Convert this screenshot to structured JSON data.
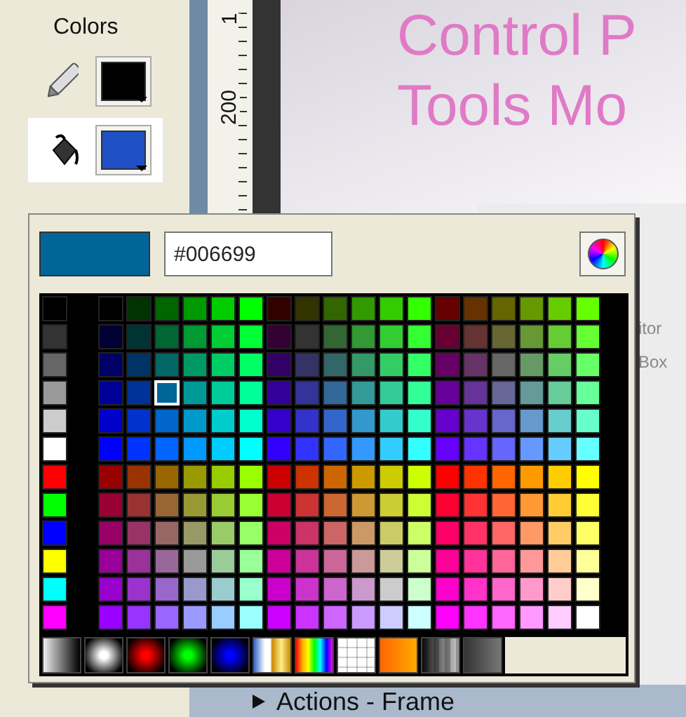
{
  "tools_panel": {
    "title": "Colors",
    "tools": [
      {
        "kind": "stroke",
        "color": "#000000",
        "selected": false
      },
      {
        "kind": "fill",
        "color": "#1f4fc4",
        "selected": true
      }
    ]
  },
  "ruler": {
    "labels": [
      "1",
      "200"
    ]
  },
  "stage": {
    "lines": [
      "Control P",
      "Tools Mo"
    ],
    "fragments": [
      "itor",
      "Box"
    ]
  },
  "palette": {
    "preview": {
      "color": "#006699"
    },
    "hex": {
      "value": "#006699"
    },
    "rows": [
      {
        "left": {
          "color": "#000000",
          "selected": false
        },
        "swatches": [
          {
            "color": "#000000",
            "selected": false
          },
          {
            "color": "#003300",
            "selected": false
          },
          {
            "color": "#006600",
            "selected": false
          },
          {
            "color": "#009900",
            "selected": false
          },
          {
            "color": "#00cc00",
            "selected": false
          },
          {
            "color": "#00ff00",
            "selected": false
          },
          {
            "color": "#330000",
            "selected": false
          },
          {
            "color": "#333300",
            "selected": false
          },
          {
            "color": "#336600",
            "selected": false
          },
          {
            "color": "#339900",
            "selected": false
          },
          {
            "color": "#33cc00",
            "selected": false
          },
          {
            "color": "#33ff00",
            "selected": false
          },
          {
            "color": "#660000",
            "selected": false
          },
          {
            "color": "#663300",
            "selected": false
          },
          {
            "color": "#666600",
            "selected": false
          },
          {
            "color": "#669900",
            "selected": false
          },
          {
            "color": "#66cc00",
            "selected": false
          },
          {
            "color": "#66ff00",
            "selected": false
          }
        ]
      },
      {
        "left": {
          "color": "#333333",
          "selected": false
        },
        "swatches": [
          {
            "color": "#000033",
            "selected": false
          },
          {
            "color": "#003333",
            "selected": false
          },
          {
            "color": "#006633",
            "selected": false
          },
          {
            "color": "#009933",
            "selected": false
          },
          {
            "color": "#00cc33",
            "selected": false
          },
          {
            "color": "#00ff33",
            "selected": false
          },
          {
            "color": "#330033",
            "selected": false
          },
          {
            "color": "#333333",
            "selected": false
          },
          {
            "color": "#336633",
            "selected": false
          },
          {
            "color": "#339933",
            "selected": false
          },
          {
            "color": "#33cc33",
            "selected": false
          },
          {
            "color": "#33ff33",
            "selected": false
          },
          {
            "color": "#660033",
            "selected": false
          },
          {
            "color": "#663333",
            "selected": false
          },
          {
            "color": "#666633",
            "selected": false
          },
          {
            "color": "#669933",
            "selected": false
          },
          {
            "color": "#66cc33",
            "selected": false
          },
          {
            "color": "#66ff33",
            "selected": false
          }
        ]
      },
      {
        "left": {
          "color": "#666666",
          "selected": false
        },
        "swatches": [
          {
            "color": "#000066",
            "selected": false
          },
          {
            "color": "#003366",
            "selected": false
          },
          {
            "color": "#006666",
            "selected": false
          },
          {
            "color": "#009966",
            "selected": false
          },
          {
            "color": "#00cc66",
            "selected": false
          },
          {
            "color": "#00ff66",
            "selected": false
          },
          {
            "color": "#330066",
            "selected": false
          },
          {
            "color": "#333366",
            "selected": false
          },
          {
            "color": "#336666",
            "selected": false
          },
          {
            "color": "#339966",
            "selected": false
          },
          {
            "color": "#33cc66",
            "selected": false
          },
          {
            "color": "#33ff66",
            "selected": false
          },
          {
            "color": "#660066",
            "selected": false
          },
          {
            "color": "#663366",
            "selected": false
          },
          {
            "color": "#666666",
            "selected": false
          },
          {
            "color": "#669966",
            "selected": false
          },
          {
            "color": "#66cc66",
            "selected": false
          },
          {
            "color": "#66ff66",
            "selected": false
          }
        ]
      },
      {
        "left": {
          "color": "#999999",
          "selected": false
        },
        "swatches": [
          {
            "color": "#000099",
            "selected": false
          },
          {
            "color": "#003399",
            "selected": false
          },
          {
            "color": "#006699",
            "selected": true
          },
          {
            "color": "#009999",
            "selected": false
          },
          {
            "color": "#00cc99",
            "selected": false
          },
          {
            "color": "#00ff99",
            "selected": false
          },
          {
            "color": "#330099",
            "selected": false
          },
          {
            "color": "#333399",
            "selected": false
          },
          {
            "color": "#336699",
            "selected": false
          },
          {
            "color": "#339999",
            "selected": false
          },
          {
            "color": "#33cc99",
            "selected": false
          },
          {
            "color": "#33ff99",
            "selected": false
          },
          {
            "color": "#660099",
            "selected": false
          },
          {
            "color": "#663399",
            "selected": false
          },
          {
            "color": "#666699",
            "selected": false
          },
          {
            "color": "#669999",
            "selected": false
          },
          {
            "color": "#66cc99",
            "selected": false
          },
          {
            "color": "#66ff99",
            "selected": false
          }
        ]
      },
      {
        "left": {
          "color": "#cccccc",
          "selected": false
        },
        "swatches": [
          {
            "color": "#0000cc",
            "selected": false
          },
          {
            "color": "#0033cc",
            "selected": false
          },
          {
            "color": "#0066cc",
            "selected": false
          },
          {
            "color": "#0099cc",
            "selected": false
          },
          {
            "color": "#00cccc",
            "selected": false
          },
          {
            "color": "#00ffcc",
            "selected": false
          },
          {
            "color": "#3300cc",
            "selected": false
          },
          {
            "color": "#3333cc",
            "selected": false
          },
          {
            "color": "#3366cc",
            "selected": false
          },
          {
            "color": "#3399cc",
            "selected": false
          },
          {
            "color": "#33cccc",
            "selected": false
          },
          {
            "color": "#33ffcc",
            "selected": false
          },
          {
            "color": "#6600cc",
            "selected": false
          },
          {
            "color": "#6633cc",
            "selected": false
          },
          {
            "color": "#6666cc",
            "selected": false
          },
          {
            "color": "#6699cc",
            "selected": false
          },
          {
            "color": "#66cccc",
            "selected": false
          },
          {
            "color": "#66ffcc",
            "selected": false
          }
        ]
      },
      {
        "left": {
          "color": "#ffffff",
          "selected": false
        },
        "swatches": [
          {
            "color": "#0000ff",
            "selected": false
          },
          {
            "color": "#0033ff",
            "selected": false
          },
          {
            "color": "#0066ff",
            "selected": false
          },
          {
            "color": "#0099ff",
            "selected": false
          },
          {
            "color": "#00ccff",
            "selected": false
          },
          {
            "color": "#00ffff",
            "selected": false
          },
          {
            "color": "#3300ff",
            "selected": false
          },
          {
            "color": "#3333ff",
            "selected": false
          },
          {
            "color": "#3366ff",
            "selected": false
          },
          {
            "color": "#3399ff",
            "selected": false
          },
          {
            "color": "#33ccff",
            "selected": false
          },
          {
            "color": "#33ffff",
            "selected": false
          },
          {
            "color": "#6600ff",
            "selected": false
          },
          {
            "color": "#6633ff",
            "selected": false
          },
          {
            "color": "#6666ff",
            "selected": false
          },
          {
            "color": "#6699ff",
            "selected": false
          },
          {
            "color": "#66ccff",
            "selected": false
          },
          {
            "color": "#66ffff",
            "selected": false
          }
        ]
      },
      {
        "left": {
          "color": "#ff0000",
          "selected": false
        },
        "swatches": [
          {
            "color": "#990000",
            "selected": false
          },
          {
            "color": "#993300",
            "selected": false
          },
          {
            "color": "#996600",
            "selected": false
          },
          {
            "color": "#999900",
            "selected": false
          },
          {
            "color": "#99cc00",
            "selected": false
          },
          {
            "color": "#99ff00",
            "selected": false
          },
          {
            "color": "#cc0000",
            "selected": false
          },
          {
            "color": "#cc3300",
            "selected": false
          },
          {
            "color": "#cc6600",
            "selected": false
          },
          {
            "color": "#cc9900",
            "selected": false
          },
          {
            "color": "#cccc00",
            "selected": false
          },
          {
            "color": "#ccff00",
            "selected": false
          },
          {
            "color": "#ff0000",
            "selected": false
          },
          {
            "color": "#ff3300",
            "selected": false
          },
          {
            "color": "#ff6600",
            "selected": false
          },
          {
            "color": "#ff9900",
            "selected": false
          },
          {
            "color": "#ffcc00",
            "selected": false
          },
          {
            "color": "#ffff00",
            "selected": false
          }
        ]
      },
      {
        "left": {
          "color": "#00ff00",
          "selected": false
        },
        "swatches": [
          {
            "color": "#990033",
            "selected": false
          },
          {
            "color": "#993333",
            "selected": false
          },
          {
            "color": "#996633",
            "selected": false
          },
          {
            "color": "#999933",
            "selected": false
          },
          {
            "color": "#99cc33",
            "selected": false
          },
          {
            "color": "#99ff33",
            "selected": false
          },
          {
            "color": "#cc0033",
            "selected": false
          },
          {
            "color": "#cc3333",
            "selected": false
          },
          {
            "color": "#cc6633",
            "selected": false
          },
          {
            "color": "#cc9933",
            "selected": false
          },
          {
            "color": "#cccc33",
            "selected": false
          },
          {
            "color": "#ccff33",
            "selected": false
          },
          {
            "color": "#ff0033",
            "selected": false
          },
          {
            "color": "#ff3333",
            "selected": false
          },
          {
            "color": "#ff6633",
            "selected": false
          },
          {
            "color": "#ff9933",
            "selected": false
          },
          {
            "color": "#ffcc33",
            "selected": false
          },
          {
            "color": "#ffff33",
            "selected": false
          }
        ]
      },
      {
        "left": {
          "color": "#0000ff",
          "selected": false
        },
        "swatches": [
          {
            "color": "#990066",
            "selected": false
          },
          {
            "color": "#993366",
            "selected": false
          },
          {
            "color": "#996666",
            "selected": false
          },
          {
            "color": "#999966",
            "selected": false
          },
          {
            "color": "#99cc66",
            "selected": false
          },
          {
            "color": "#99ff66",
            "selected": false
          },
          {
            "color": "#cc0066",
            "selected": false
          },
          {
            "color": "#cc3366",
            "selected": false
          },
          {
            "color": "#cc6666",
            "selected": false
          },
          {
            "color": "#cc9966",
            "selected": false
          },
          {
            "color": "#cccc66",
            "selected": false
          },
          {
            "color": "#ccff66",
            "selected": false
          },
          {
            "color": "#ff0066",
            "selected": false
          },
          {
            "color": "#ff3366",
            "selected": false
          },
          {
            "color": "#ff6666",
            "selected": false
          },
          {
            "color": "#ff9966",
            "selected": false
          },
          {
            "color": "#ffcc66",
            "selected": false
          },
          {
            "color": "#ffff66",
            "selected": false
          }
        ]
      },
      {
        "left": {
          "color": "#ffff00",
          "selected": false
        },
        "swatches": [
          {
            "color": "#990099",
            "selected": false
          },
          {
            "color": "#993399",
            "selected": false
          },
          {
            "color": "#996699",
            "selected": false
          },
          {
            "color": "#999999",
            "selected": false
          },
          {
            "color": "#99cc99",
            "selected": false
          },
          {
            "color": "#99ff99",
            "selected": false
          },
          {
            "color": "#cc0099",
            "selected": false
          },
          {
            "color": "#cc3399",
            "selected": false
          },
          {
            "color": "#cc6699",
            "selected": false
          },
          {
            "color": "#cc9999",
            "selected": false
          },
          {
            "color": "#cccc99",
            "selected": false
          },
          {
            "color": "#ccff99",
            "selected": false
          },
          {
            "color": "#ff0099",
            "selected": false
          },
          {
            "color": "#ff3399",
            "selected": false
          },
          {
            "color": "#ff6699",
            "selected": false
          },
          {
            "color": "#ff9999",
            "selected": false
          },
          {
            "color": "#ffcc99",
            "selected": false
          },
          {
            "color": "#ffff99",
            "selected": false
          }
        ]
      },
      {
        "left": {
          "color": "#00ffff",
          "selected": false
        },
        "swatches": [
          {
            "color": "#9900cc",
            "selected": false
          },
          {
            "color": "#9933cc",
            "selected": false
          },
          {
            "color": "#9966cc",
            "selected": false
          },
          {
            "color": "#9999cc",
            "selected": false
          },
          {
            "color": "#99cccc",
            "selected": false
          },
          {
            "color": "#99ffcc",
            "selected": false
          },
          {
            "color": "#cc00cc",
            "selected": false
          },
          {
            "color": "#cc33cc",
            "selected": false
          },
          {
            "color": "#cc66cc",
            "selected": false
          },
          {
            "color": "#cc99cc",
            "selected": false
          },
          {
            "color": "#cccccc",
            "selected": false
          },
          {
            "color": "#ccffcc",
            "selected": false
          },
          {
            "color": "#ff00cc",
            "selected": false
          },
          {
            "color": "#ff33cc",
            "selected": false
          },
          {
            "color": "#ff66cc",
            "selected": false
          },
          {
            "color": "#ff99cc",
            "selected": false
          },
          {
            "color": "#ffcccc",
            "selected": false
          },
          {
            "color": "#ffffcc",
            "selected": false
          }
        ]
      },
      {
        "left": {
          "color": "#ff00ff",
          "selected": false
        },
        "swatches": [
          {
            "color": "#9900ff",
            "selected": false
          },
          {
            "color": "#9933ff",
            "selected": false
          },
          {
            "color": "#9966ff",
            "selected": false
          },
          {
            "color": "#9999ff",
            "selected": false
          },
          {
            "color": "#99ccff",
            "selected": false
          },
          {
            "color": "#99ffff",
            "selected": false
          },
          {
            "color": "#cc00ff",
            "selected": false
          },
          {
            "color": "#cc33ff",
            "selected": false
          },
          {
            "color": "#cc66ff",
            "selected": false
          },
          {
            "color": "#cc99ff",
            "selected": false
          },
          {
            "color": "#ccccff",
            "selected": false
          },
          {
            "color": "#ccffff",
            "selected": false
          },
          {
            "color": "#ff00ff",
            "selected": false
          },
          {
            "color": "#ff33ff",
            "selected": false
          },
          {
            "color": "#ff66ff",
            "selected": false
          },
          {
            "color": "#ff99ff",
            "selected": false
          },
          {
            "color": "#ffccff",
            "selected": false
          },
          {
            "color": "#ffffff",
            "selected": false
          }
        ]
      }
    ],
    "gradients": [
      {
        "kind": "grayscale"
      },
      {
        "kind": "radial",
        "color": "#ffffff"
      },
      {
        "kind": "radial",
        "color": "#ff0000"
      },
      {
        "kind": "radial",
        "color": "#00ff00"
      },
      {
        "kind": "radial",
        "color": "#0000ff"
      },
      {
        "kind": "chrome"
      },
      {
        "kind": "rainbow"
      },
      {
        "kind": "grid"
      },
      {
        "kind": "sunset"
      },
      {
        "kind": "mesh"
      },
      {
        "kind": "shade"
      }
    ]
  },
  "actions_panel": {
    "title": "Actions - Frame"
  }
}
